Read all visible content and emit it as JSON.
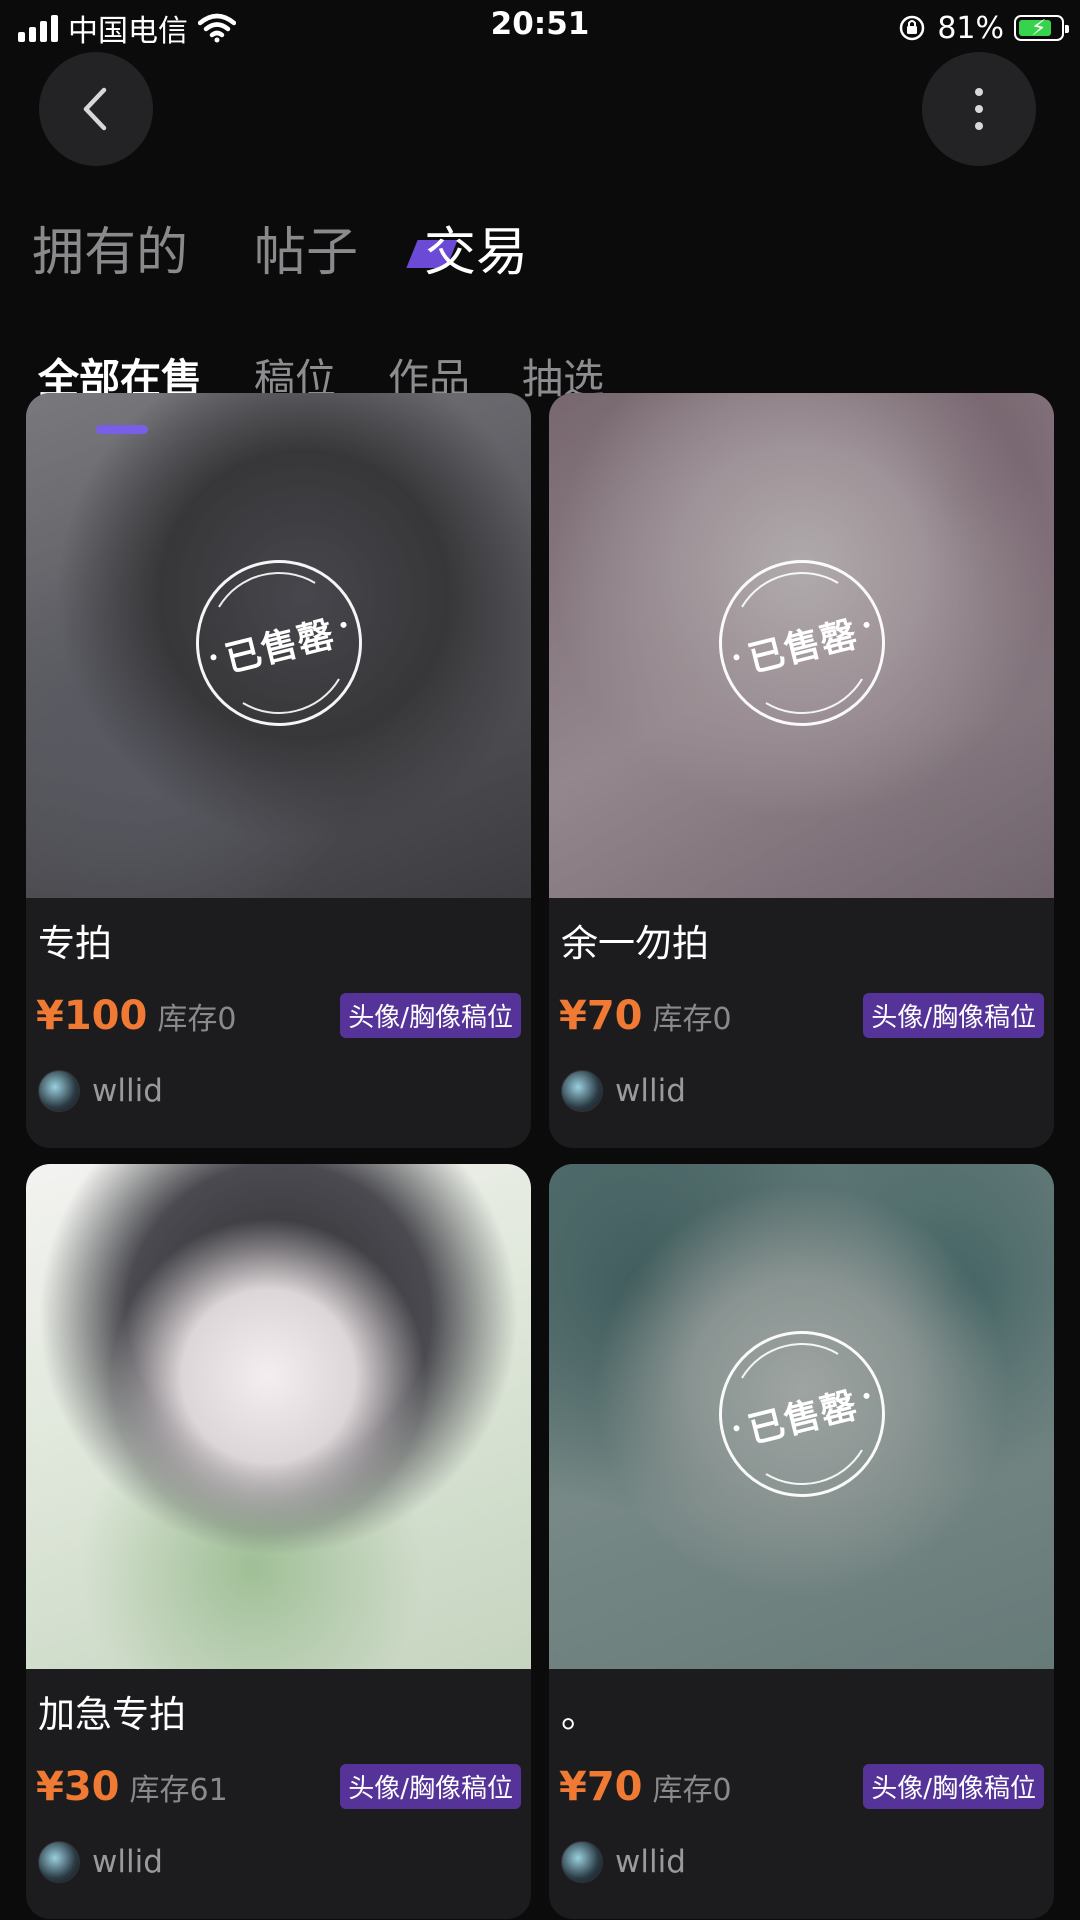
{
  "status_bar": {
    "carrier": "中国电信",
    "time": "20:51",
    "battery_percent": "81%",
    "battery_level": 0.81,
    "icons": [
      "signal-icon",
      "wifi-icon",
      "rotation-lock-icon",
      "battery-charging-icon"
    ]
  },
  "header": {
    "back_icon": "chevron-left-icon",
    "more_icon": "more-vertical-icon"
  },
  "main_tabs": [
    {
      "label": "拥有的",
      "active": false
    },
    {
      "label": "帖子",
      "active": false
    },
    {
      "label": "交易",
      "active": true
    }
  ],
  "sub_tabs": [
    {
      "label": "全部在售",
      "active": true
    },
    {
      "label": "稿位",
      "active": false
    },
    {
      "label": "作品",
      "active": false
    },
    {
      "label": "抽选",
      "active": false
    }
  ],
  "colors": {
    "accent": "#7b5ee8",
    "price": "#f07a33",
    "tag_bg": "#553399"
  },
  "cards": [
    {
      "title": "专拍",
      "price": "¥100",
      "stock": "库存0",
      "tag": "头像/胸像稿位",
      "seller": "wllid",
      "sold_out": true,
      "stamp": "已售罄"
    },
    {
      "title": "余一勿拍",
      "price": "¥70",
      "stock": "库存0",
      "tag": "头像/胸像稿位",
      "seller": "wllid",
      "sold_out": true,
      "stamp": "已售罄"
    },
    {
      "title": "加急专拍",
      "price": "¥30",
      "stock": "库存61",
      "tag": "头像/胸像稿位",
      "seller": "wllid",
      "sold_out": false,
      "stamp": ""
    },
    {
      "title": "。",
      "price": "¥70",
      "stock": "库存0",
      "tag": "头像/胸像稿位",
      "seller": "wllid",
      "sold_out": true,
      "stamp": "已售罄"
    }
  ]
}
